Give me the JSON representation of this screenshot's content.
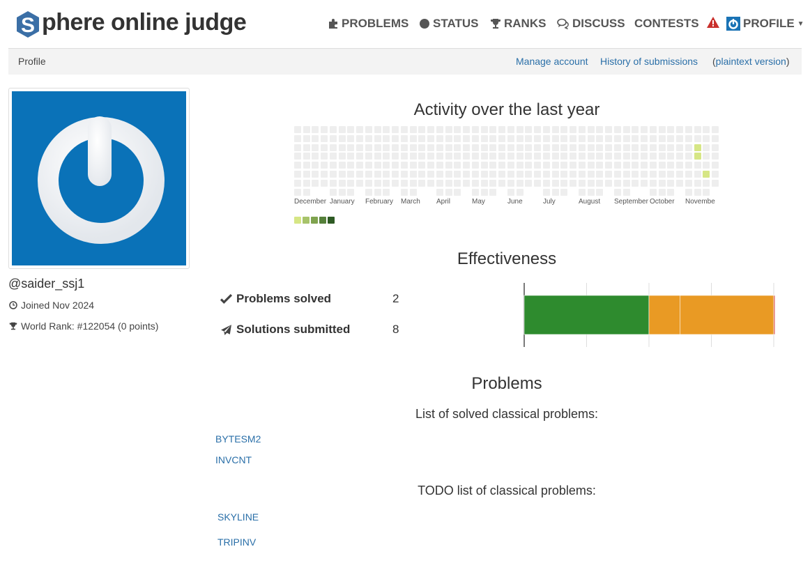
{
  "brand": {
    "letter": "S",
    "text": "phere online judge"
  },
  "nav": {
    "problems": "PROBLEMS",
    "status": "STATUS",
    "ranks": "RANKS",
    "discuss": "DISCUSS",
    "contests": "CONTESTS",
    "profile": "PROFILE"
  },
  "subbar": {
    "title": "Profile",
    "manage": "Manage account",
    "history": "History of submissions",
    "plaintext": "plaintext version"
  },
  "user": {
    "handle": "@saider_ssj1",
    "joined": "Joined Nov 2024",
    "rank": "World Rank: #122054 (0 points)"
  },
  "activity": {
    "title": "Activity over the last year",
    "months": [
      "December",
      "January",
      "February",
      "March",
      "April",
      "May",
      "June",
      "July",
      "August",
      "September",
      "October",
      "Novembe"
    ],
    "active_cells": [
      {
        "month": "November",
        "week": 1,
        "day": 2,
        "level": 1
      },
      {
        "month": "November",
        "week": 1,
        "day": 3,
        "level": 1
      },
      {
        "month": "November",
        "week": 2,
        "day": 5,
        "level": 1
      },
      {
        "month": "November",
        "week": 2,
        "day": 8,
        "level": 1
      }
    ],
    "legend_colors": [
      "#d6e685",
      "#a7c36a",
      "#7fa34f",
      "#55803a",
      "#2e5a24"
    ]
  },
  "effectiveness": {
    "title": "Effectiveness",
    "solved_label": "Problems solved",
    "solved_value": "2",
    "submitted_label": "Solutions submitted",
    "submitted_value": "8",
    "chart_data": {
      "type": "bar",
      "orientation": "horizontal-stacked",
      "series": [
        {
          "value": 2,
          "color": "#2e8b2e"
        },
        {
          "value": 0.5,
          "color": "#e99a24"
        },
        {
          "value": 1.5,
          "color": "#e99a24"
        },
        {
          "value": 0.02,
          "color": "#d9534f"
        }
      ],
      "xlim": [
        0,
        4
      ],
      "grid": true
    }
  },
  "problems": {
    "title": "Problems",
    "solved_heading": "List of solved classical problems:",
    "solved": [
      "BYTESM2",
      "INVCNT"
    ],
    "todo_heading": "TODO list of classical problems:",
    "todo": [
      "SKYLINE",
      "TRIPINV"
    ]
  }
}
